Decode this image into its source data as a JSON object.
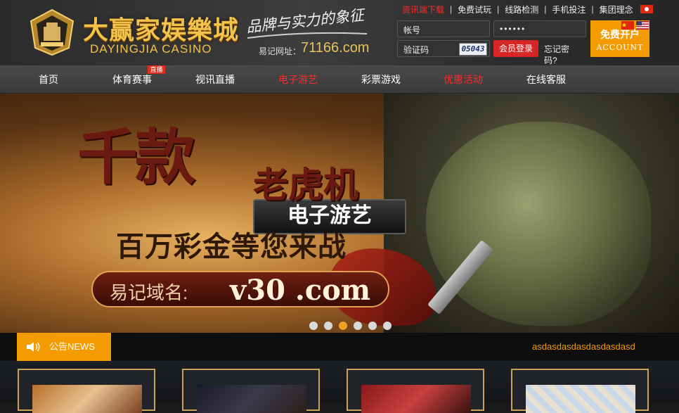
{
  "brand": {
    "name_cn": "大赢家娱樂城",
    "name_en": "DAYINGJIA CASINO",
    "slogan": "品牌与实力的象征",
    "domain_label": "易记网址：",
    "domain_value": "71166.com"
  },
  "toplinks": [
    {
      "label": "资讯端下载",
      "color": "#ff2a2a"
    },
    {
      "label": "免费试玩"
    },
    {
      "label": "线路检测"
    },
    {
      "label": "手机投注"
    },
    {
      "label": "集团理念"
    }
  ],
  "login": {
    "username_placeholder": "帐号",
    "password_value": "••••••",
    "captcha_placeholder": "验证码",
    "captcha_code": "05043",
    "login_label": "会员登录",
    "forgot_label": "忘记密码?"
  },
  "account": {
    "cn": "免费开户",
    "en": "ACCOUNT"
  },
  "nav": {
    "items": [
      {
        "label": "首页"
      },
      {
        "label": "体育赛事",
        "badge": "直播"
      },
      {
        "label": "视讯直播"
      },
      {
        "label": "电子游艺",
        "color": "#ff2a2a"
      },
      {
        "label": "彩票游戏"
      },
      {
        "label": "优惠活动",
        "color": "#ff2a2a"
      },
      {
        "label": "在线客服"
      }
    ]
  },
  "banner": {
    "tag": "电子游艺",
    "title_big": "千款",
    "title_mid": "老虎机",
    "subtitle": "百万彩金等您来战",
    "domain_label": "易记域名:",
    "domain_value": "v30 .com",
    "slide_count": 6,
    "active_slide": 2
  },
  "notice": {
    "label": "公告NEWS",
    "text": "asdasdasdasdasdasdasd"
  },
  "colors": {
    "accent": "#f39b00",
    "red": "#ff2a2a",
    "gold": "#c7a45a"
  }
}
